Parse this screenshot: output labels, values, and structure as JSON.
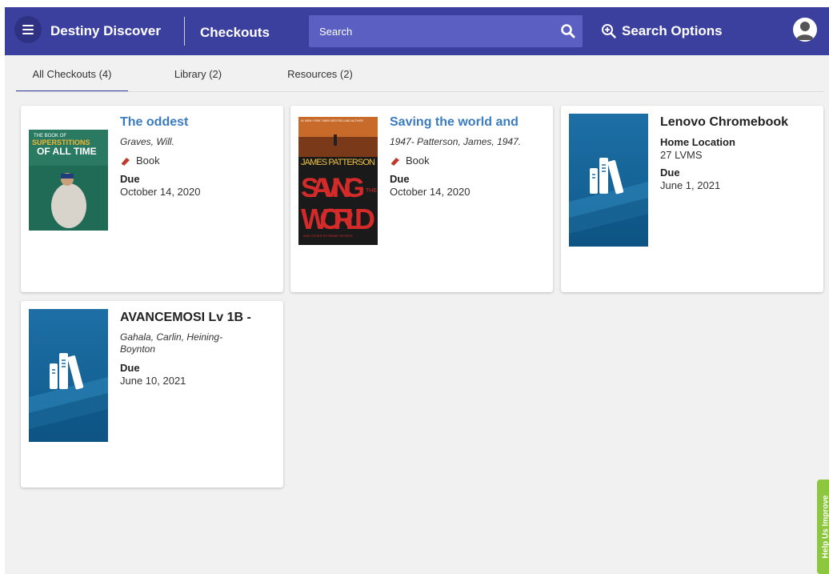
{
  "header": {
    "app_title": "Destiny Discover",
    "section_title": "Checkouts",
    "search_placeholder": "Search",
    "search_options_label": "Search Options",
    "brand_color": "#3b3f9e"
  },
  "tabs": [
    {
      "label": "All Checkouts (4)",
      "active": true
    },
    {
      "label": "Library (2)",
      "active": false
    },
    {
      "label": "Resources (2)",
      "active": false
    }
  ],
  "cards": [
    {
      "title": "The oddest",
      "author": "Graves, Will.",
      "format": "Book",
      "due_label": "Due",
      "due_date": "October 14, 2020",
      "cover_text_top": "THE BOOK OF",
      "cover_text_main": "SUPERSTITIONS",
      "cover_text_sub": "OF ALL TIME"
    },
    {
      "title": "Saving the world and",
      "author": "1947- Patterson, James, 1947.",
      "format": "Book",
      "due_label": "Due",
      "due_date": "October 14, 2020",
      "cover_text_top": "#1 NEW YORK TIMES BESTSELLING AUTHOR",
      "cover_text_author": "JAMES PATTERSON",
      "cover_text_line1": "SAVING",
      "cover_text_small": "THE",
      "cover_text_line2": "WORLD",
      "cover_text_bottom": "AND OTHER EXTREME SPORTS"
    },
    {
      "title": "Lenovo Chromebook",
      "location_label": "Home Location",
      "location_value": "27 LVMS",
      "due_label": "Due",
      "due_date": "June 1, 2021"
    },
    {
      "title": "AVANCEMOSI Lv 1B -",
      "author": "Gahala, Carlin, Heining-Boynton",
      "due_label": "Due",
      "due_date": "June 10, 2021"
    }
  ],
  "help_tab_label": "Help Us Improve"
}
